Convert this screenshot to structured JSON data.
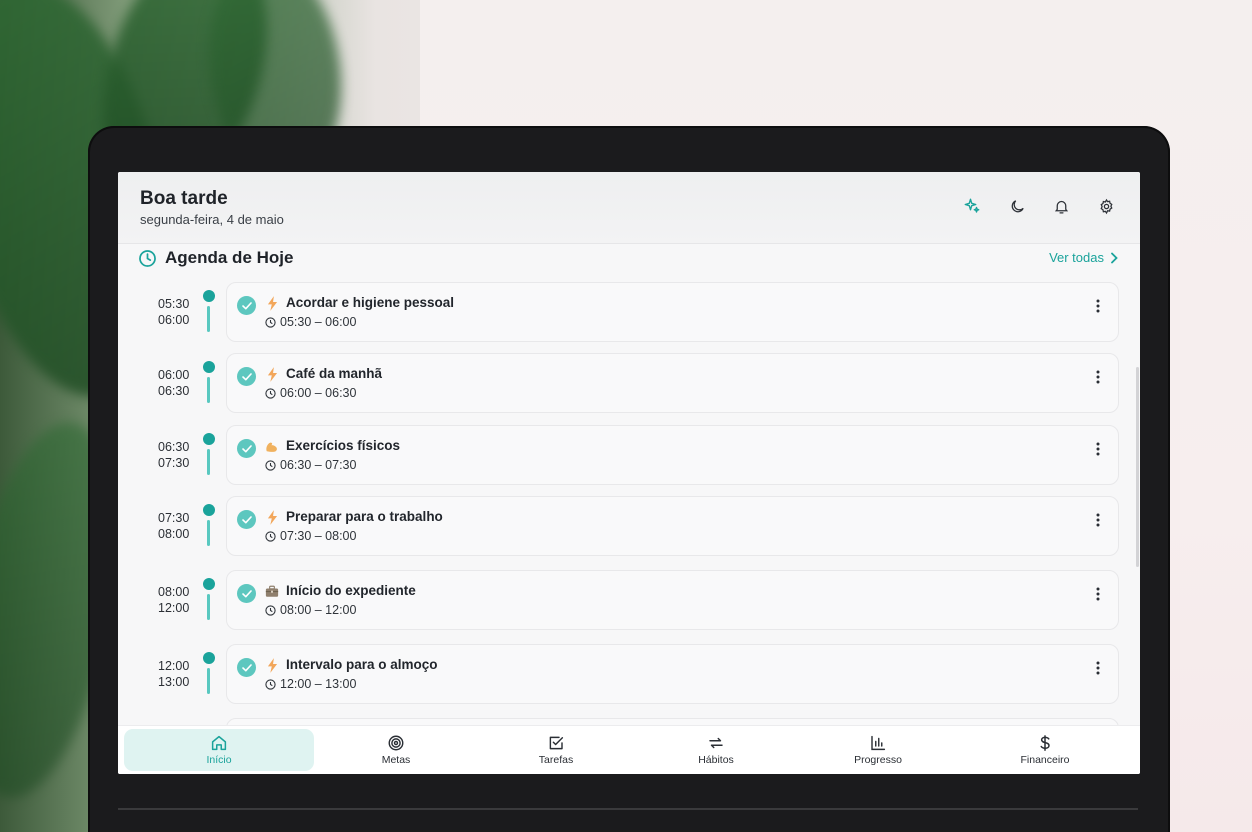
{
  "header": {
    "greeting": "Boa tarde",
    "date": "segunda-feira, 4 de maio",
    "icons": [
      "sparkles-icon",
      "moon-icon",
      "bell-icon",
      "gear-icon"
    ]
  },
  "agenda": {
    "title": "Agenda de Hoje",
    "see_all": "Ver todas",
    "items": [
      {
        "start": "05:30",
        "end": "06:00",
        "title": "Acordar e higiene pessoal",
        "range": "05:30 – 06:00",
        "icon": "lightning-icon"
      },
      {
        "start": "06:00",
        "end": "06:30",
        "title": "Café da manhã",
        "range": "06:00 – 06:30",
        "icon": "lightning-icon"
      },
      {
        "start": "06:30",
        "end": "07:30",
        "title": "Exercícios físicos",
        "range": "06:30 – 07:30",
        "icon": "flexed-biceps-icon"
      },
      {
        "start": "07:30",
        "end": "08:00",
        "title": "Preparar para o trabalho",
        "range": "07:30 – 08:00",
        "icon": "lightning-icon"
      },
      {
        "start": "08:00",
        "end": "12:00",
        "title": "Início do expediente",
        "range": "08:00 – 12:00",
        "icon": "briefcase-icon"
      },
      {
        "start": "12:00",
        "end": "13:00",
        "title": "Intervalo para o almoço",
        "range": "12:00 – 13:00",
        "icon": "lightning-icon"
      }
    ]
  },
  "nav": {
    "items": [
      {
        "label": "Início",
        "icon": "home-icon",
        "active": true
      },
      {
        "label": "Metas",
        "icon": "target-icon"
      },
      {
        "label": "Tarefas",
        "icon": "checkbox-icon"
      },
      {
        "label": "Hábitos",
        "icon": "repeat-icon"
      },
      {
        "label": "Progresso",
        "icon": "bar-chart-icon"
      },
      {
        "label": "Financeiro",
        "icon": "dollar-icon"
      }
    ]
  },
  "colors": {
    "accent": "#1aa39b",
    "accent_light": "#5dc7bf",
    "active_nav_bg": "#dff3f1",
    "lightning": "#f2a65a"
  }
}
